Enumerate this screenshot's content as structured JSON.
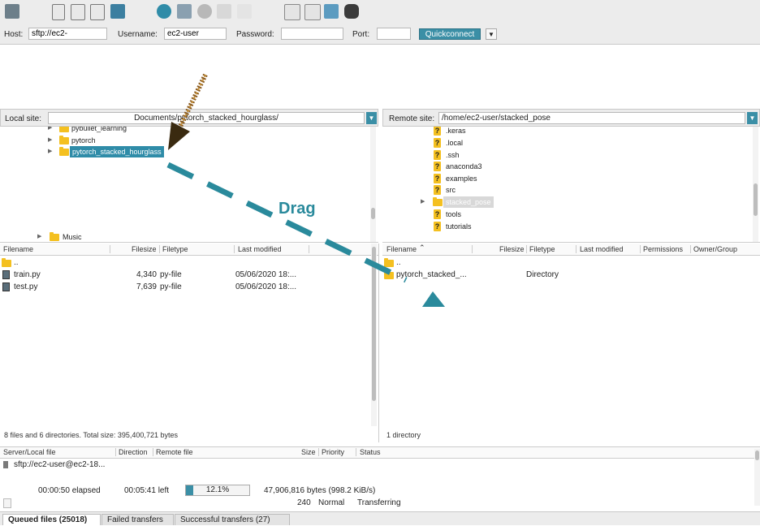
{
  "quickconnect": {
    "host_label": "Host:",
    "host_value": "sftp://ec2-",
    "username_label": "Username:",
    "username_value": "ec2-user",
    "password_label": "Password:",
    "port_label": "Port:",
    "button_label": "Quickconnect"
  },
  "local": {
    "site_label": "Local site:",
    "site_path": "Documents/pytorch_stacked_hourglass/",
    "tree": [
      {
        "label": "pybullet_learning"
      },
      {
        "label": "pytorch"
      },
      {
        "label": "pytorch_stacked_hourglass"
      },
      {
        "label": "Music"
      }
    ],
    "columns": [
      "Filename",
      "Filesize",
      "Filetype",
      "Last modified"
    ],
    "files": [
      {
        "name": "..",
        "size": "",
        "type": "",
        "modified": ""
      },
      {
        "name": "train.py",
        "size": "4,340",
        "type": "py-file",
        "modified": "05/06/2020 18:..."
      },
      {
        "name": "test.py",
        "size": "7,639",
        "type": "py-file",
        "modified": "05/06/2020 18:..."
      }
    ],
    "status": "8 files and 6 directories. Total size: 395,400,721 bytes"
  },
  "remote": {
    "site_label": "Remote site:",
    "site_path": "/home/ec2-user/stacked_pose",
    "tree": [
      {
        "label": ".keras"
      },
      {
        "label": ".local"
      },
      {
        "label": ".ssh"
      },
      {
        "label": "anaconda3"
      },
      {
        "label": "examples"
      },
      {
        "label": "src"
      },
      {
        "label": "stacked_pose"
      },
      {
        "label": "tools"
      },
      {
        "label": "tutorials"
      }
    ],
    "columns": [
      "Filename",
      "Filesize",
      "Filetype",
      "Last modified",
      "Permissions",
      "Owner/Group"
    ],
    "files": [
      {
        "name": "..",
        "type": ""
      },
      {
        "name": "pytorch_stacked_...",
        "type": "Directory"
      }
    ],
    "status": "1 directory"
  },
  "annotation": {
    "drag_label": "Drag"
  },
  "queue": {
    "columns": [
      "Server/Local file",
      "Direction",
      "Remote file",
      "Size",
      "Priority",
      "Status"
    ],
    "server": "sftp://ec2-user@ec2-18...",
    "elapsed": "00:00:50 elapsed",
    "left": "00:05:41 left",
    "progress_text": "12.1%",
    "progress_fraction": 0.121,
    "bytes": "47,906,816 bytes (998.2 KiB/s)",
    "size": "240",
    "priority": "Normal",
    "status": "Transferring"
  },
  "tabs": [
    {
      "label": "Queued files (25018)"
    },
    {
      "label": "Failed transfers"
    },
    {
      "label": "Successful transfers (27)"
    }
  ],
  "colors": {
    "accent": "#3b8fa6",
    "folder": "#f4c020",
    "drag_arrow": "#2a8a9c",
    "pointer_arrow": "#8a5a1e"
  }
}
